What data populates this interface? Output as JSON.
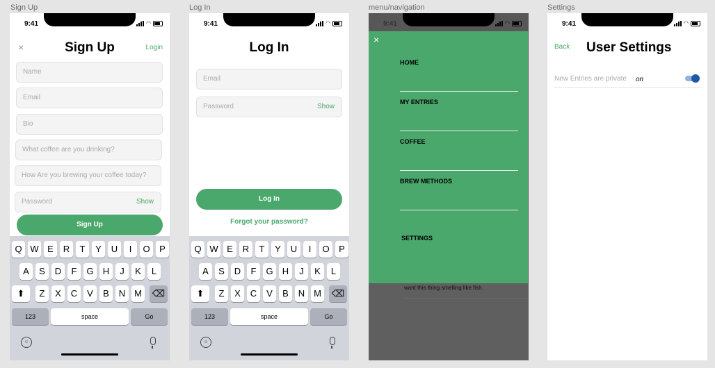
{
  "frames": {
    "signup": {
      "label": "Sign Up",
      "time": "9:41",
      "close": "×",
      "title": "Sign Up",
      "login_link": "Login",
      "fields": [
        "Name",
        "Email",
        "Bio",
        "What coffee are you drinking?",
        "How Are you brewing  your coffee today?",
        "Password"
      ],
      "show": "Show",
      "button": "Sign Up"
    },
    "login": {
      "label": "Log In",
      "time": "9:41",
      "title": "Log In",
      "email": "Email",
      "password": "Password",
      "show": "Show",
      "button": "Log In",
      "forgot": "Forgot your password?"
    },
    "menu": {
      "label": "menu/navigation",
      "time": "9:41",
      "close": "×",
      "items": [
        "HOME",
        "MY ENTRIES",
        "COFFEE",
        "BREW METHODS",
        "SETTINGS"
      ],
      "peek_text": "want this thing smelling like fish."
    },
    "settings": {
      "label": "Settings",
      "time": "9:41",
      "back": "Back",
      "title": "User Settings",
      "row_label": "New Entries are private",
      "row_value": "on",
      "toggle_on": true,
      "accent": "#4aa86c",
      "toggle_knob_color": "#1e58a6"
    }
  },
  "keyboard": {
    "row1": [
      "Q",
      "W",
      "E",
      "R",
      "T",
      "Y",
      "U",
      "I",
      "O",
      "P"
    ],
    "row2": [
      "A",
      "S",
      "D",
      "F",
      "G",
      "H",
      "J",
      "K",
      "L"
    ],
    "row3": [
      "Z",
      "X",
      "C",
      "V",
      "B",
      "N",
      "M"
    ],
    "k123": "123",
    "space": "space",
    "go": "Go",
    "shift": "⬆",
    "delete": "⌫",
    "emoji": "☺"
  },
  "colors": {
    "green": "#4aa86c",
    "menu_green": "#4aa86c",
    "dim": "#5f5f5f"
  }
}
